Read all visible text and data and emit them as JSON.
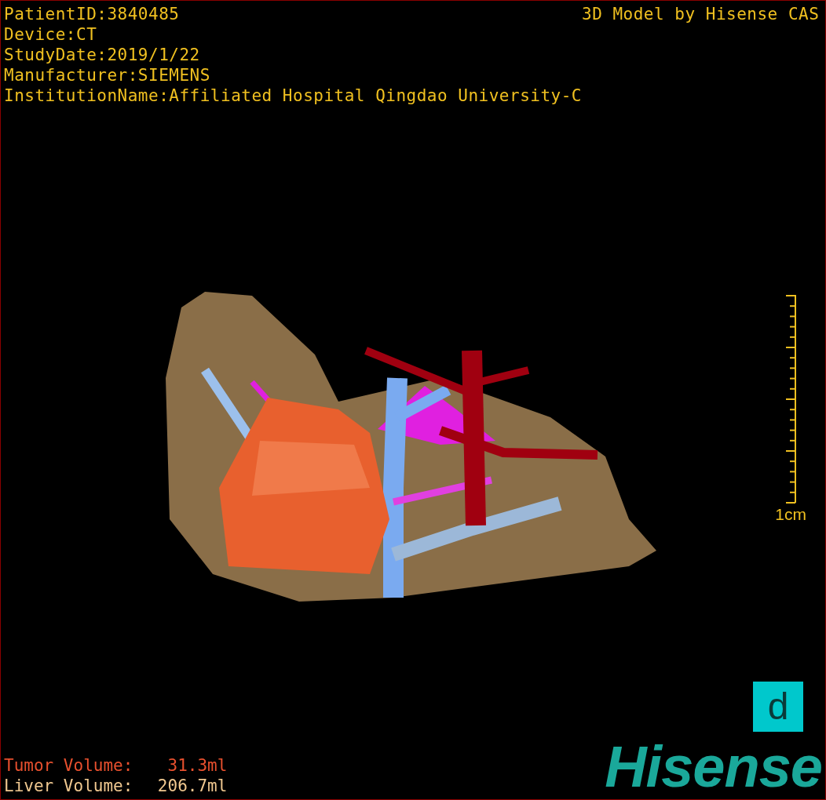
{
  "header": {
    "info_lines": [
      "PatientID:3840485",
      "Device:CT",
      "StudyDate:2019/1/22",
      "Manufacturer:SIEMENS",
      "InstitutionName:Affiliated Hospital Qingdao University-C"
    ],
    "credit": "3D Model by Hisense CAS"
  },
  "scale_bar": {
    "label": "1cm"
  },
  "volumes": [
    {
      "kind": "tumor",
      "label": "Tumor Volume:",
      "value": "31.3ml"
    },
    {
      "kind": "liver",
      "label": "Liver Volume:",
      "value": "206.7ml"
    }
  ],
  "d_button": {
    "label": "d"
  },
  "logo": {
    "text": "Hisense"
  }
}
